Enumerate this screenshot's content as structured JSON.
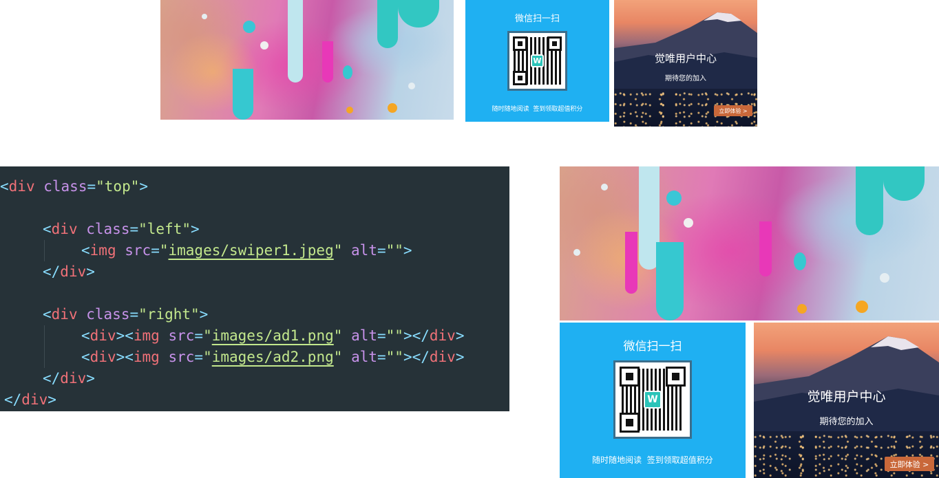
{
  "top_preview": {
    "ad1": {
      "title": "微信扫一扫",
      "caption": "随时随地阅读  签到领取超值积分",
      "qr_logo": "W"
    },
    "ad2": {
      "title": "觉唯用户中心",
      "subtitle": "期待您的加入",
      "button": "立即体验 >"
    }
  },
  "code": {
    "open_tag": "div",
    "top_class": "top",
    "left_class": "left",
    "left_img_src": "images/swiper1.jpeg",
    "right_class": "right",
    "ad1_src": "images/ad1.png",
    "ad2_src": "images/ad2.png",
    "attr_class": "class",
    "attr_src": "src",
    "attr_alt": "alt",
    "img_tag": "img",
    "alt_value": "",
    "colors": {
      "background": "#263238",
      "tag": "#f07178",
      "attribute": "#c792ea",
      "string": "#c3e88d",
      "punctuation": "#89ddff"
    }
  },
  "side_preview": {
    "ad1": {
      "title": "微信扫一扫",
      "caption": "随时随地阅读  签到领取超值积分",
      "qr_logo": "W"
    },
    "ad2": {
      "title": "觉唯用户中心",
      "subtitle": "期待您的加入",
      "button": "立即体验 >"
    }
  },
  "accent_colors": {
    "qr_blue": "#1fb0f2",
    "button_orange": "#c9683a",
    "qr_logo_teal": "#2bc4b9"
  }
}
